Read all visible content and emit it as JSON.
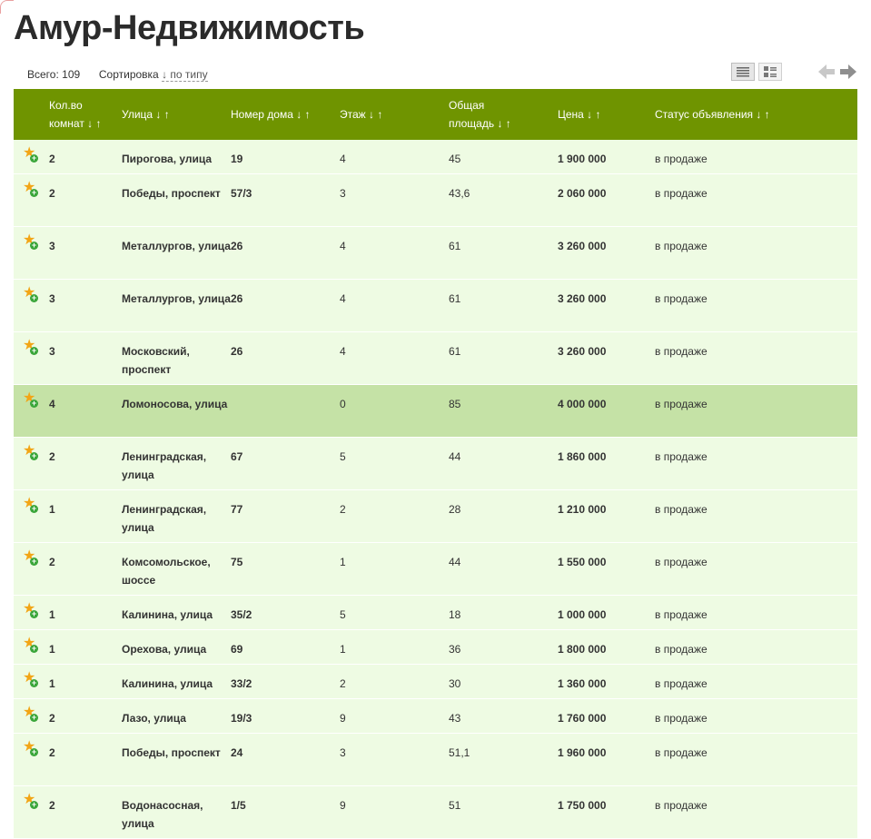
{
  "title": "Амур-Недвижимость",
  "toolbar": {
    "total_label": "Всего:",
    "total_value": "109",
    "sort_label": "Сортировка",
    "sort_value": "↓ по типу"
  },
  "icons": {
    "list_view": "list-view-icon",
    "grid_view": "grid-view-icon",
    "prev": "arrow-left-icon",
    "next": "arrow-right-icon",
    "favorite": "star-add-icon"
  },
  "colors": {
    "header_bg": "#6f9400",
    "row_bg": "#eefbe3",
    "row_highlight": "#c5e2a6",
    "link": "#2a7fc0",
    "star": "#f2a516"
  },
  "table": {
    "headers": {
      "rooms_line1": "Кол.во",
      "rooms_line2": "комнат ↓ ↑",
      "street": "Улица ↓ ↑",
      "house": "Номер дома ↓ ↑",
      "floor": "Этаж ↓ ↑",
      "area_line1": "Общая",
      "area_line2": "площадь ↓ ↑",
      "price": "Цена ↓ ↑",
      "status": "Статус объявления ↓ ↑"
    },
    "rows": [
      {
        "rooms": "2",
        "street": "Пирогова, улица",
        "house": "19",
        "floor": "4",
        "area": "45",
        "price": "1 900 000",
        "status": "в продаже"
      },
      {
        "rooms": "2",
        "street": "Победы, проспект",
        "house": "57/3",
        "floor": "3",
        "area": "43,6",
        "price": "2 060 000",
        "status": "в продаже"
      },
      {
        "rooms": "3",
        "street": "Металлургов, улица",
        "house": "26",
        "floor": "4",
        "area": "61",
        "price": "3 260 000",
        "status": "в продаже"
      },
      {
        "rooms": "3",
        "street": "Металлургов, улица",
        "house": "26",
        "floor": "4",
        "area": "61",
        "price": "3 260 000",
        "status": "в продаже"
      },
      {
        "rooms": "3",
        "street": "Московский, проспект",
        "house": "26",
        "floor": "4",
        "area": "61",
        "price": "3 260 000",
        "status": "в продаже"
      },
      {
        "rooms": "4",
        "street": "Ломоносова, улица",
        "house": "",
        "floor": "0",
        "area": "85",
        "price": "4 000 000",
        "status": "в продаже"
      },
      {
        "rooms": "2",
        "street": "Ленинградская, улица",
        "house": "67",
        "floor": "5",
        "area": "44",
        "price": "1 860 000",
        "status": "в продаже"
      },
      {
        "rooms": "1",
        "street": "Ленинградская, улица",
        "house": "77",
        "floor": "2",
        "area": "28",
        "price": "1 210 000",
        "status": "в продаже"
      },
      {
        "rooms": "2",
        "street": "Комсомольское, шоссе",
        "house": "75",
        "floor": "1",
        "area": "44",
        "price": "1 550 000",
        "status": "в продаже"
      },
      {
        "rooms": "1",
        "street": "Калинина, улица",
        "house": "35/2",
        "floor": "5",
        "area": "18",
        "price": "1 000 000",
        "status": "в продаже"
      },
      {
        "rooms": "1",
        "street": "Орехова, улица",
        "house": "69",
        "floor": "1",
        "area": "36",
        "price": "1 800 000",
        "status": "в продаже"
      },
      {
        "rooms": "1",
        "street": "Калинина, улица",
        "house": "33/2",
        "floor": "2",
        "area": "30",
        "price": "1 360 000",
        "status": "в продаже"
      },
      {
        "rooms": "2",
        "street": "Лазо, улица",
        "house": "19/3",
        "floor": "9",
        "area": "43",
        "price": "1 760 000",
        "status": "в продаже"
      },
      {
        "rooms": "2",
        "street": "Победы, проспект",
        "house": "24",
        "floor": "3",
        "area": "51,1",
        "price": "1 960 000",
        "status": "в продаже"
      },
      {
        "rooms": "2",
        "street": "Водонасосная, улица",
        "house": "1/5",
        "floor": "9",
        "area": "51",
        "price": "1 750 000",
        "status": "в продаже"
      }
    ]
  }
}
